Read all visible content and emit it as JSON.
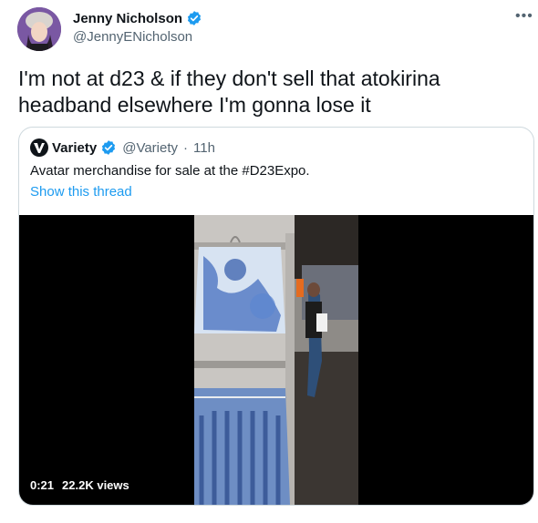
{
  "author": {
    "name": "Jenny Nicholson",
    "handle": "@JennyENicholson",
    "more_icon": "more-icon",
    "verified_icon": "verified-badge-icon"
  },
  "tweet": {
    "text": "I'm not at d23 & if they don't sell that atokirina headband elsewhere I'm gonna lose it"
  },
  "quote": {
    "name": "Variety",
    "handle": "@Variety",
    "separator": "·",
    "time": "11h",
    "text": "Avatar merchandise for sale at the #D23Expo.",
    "show_thread": "Show this thread",
    "logo_icon": "variety-logo-icon"
  },
  "video": {
    "duration": "0:21",
    "views": "22.2K views"
  },
  "colors": {
    "link": "#1d9bf0",
    "verified": "#1d9bf0",
    "muted": "#536471",
    "border": "#cfd9de"
  }
}
